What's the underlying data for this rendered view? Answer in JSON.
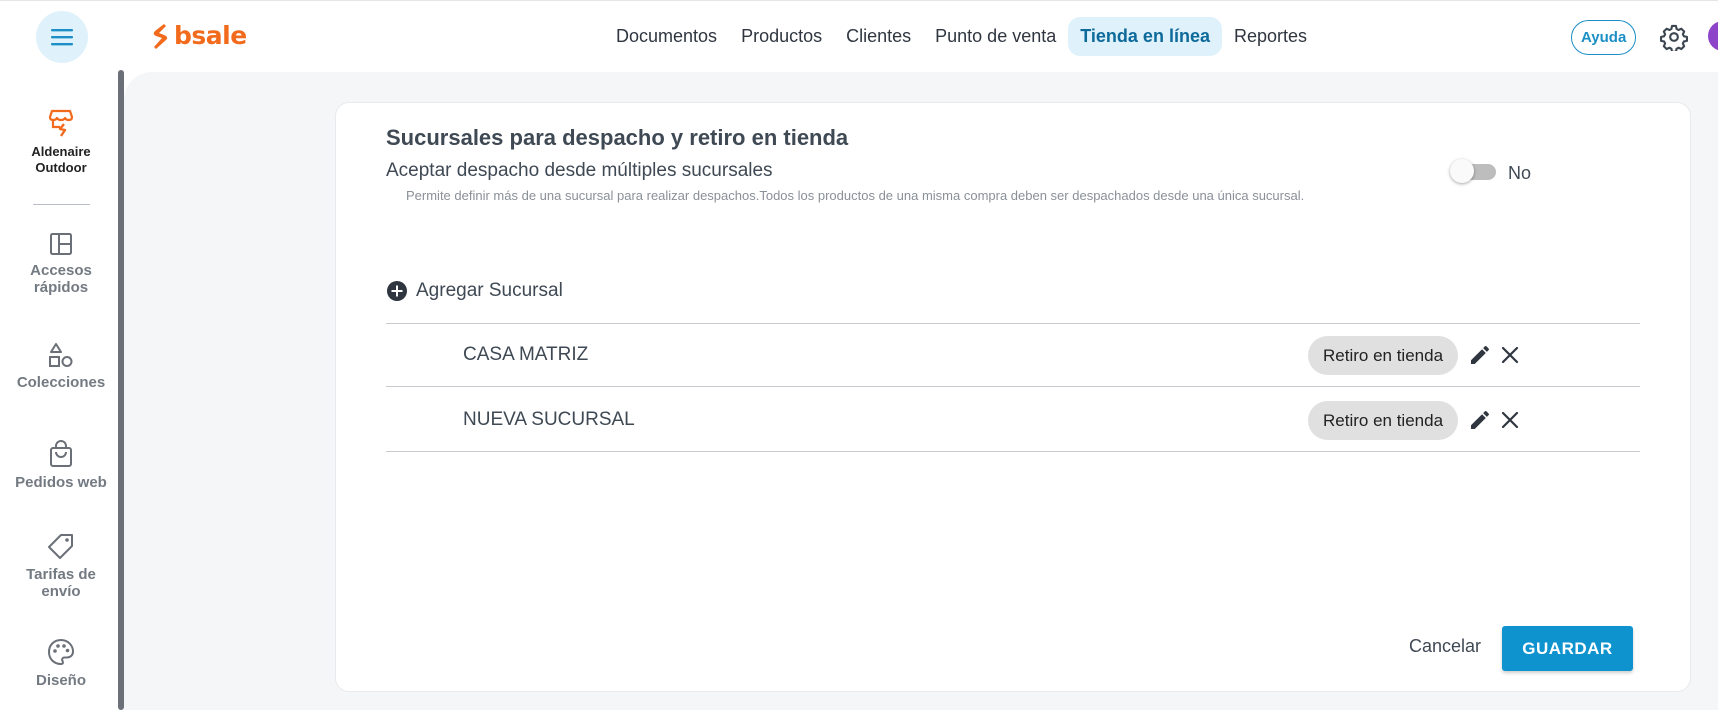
{
  "header": {
    "logo_text": "bsale",
    "nav": [
      {
        "label": "Documentos"
      },
      {
        "label": "Productos"
      },
      {
        "label": "Clientes"
      },
      {
        "label": "Punto de venta"
      },
      {
        "label": "Tienda en línea",
        "active": true
      },
      {
        "label": "Reportes"
      }
    ],
    "help_label": "Ayuda",
    "colors": {
      "brand": "#f26b1d",
      "accent": "#0e93cf",
      "active_bg": "#dff1fb"
    }
  },
  "sidebar": {
    "store": {
      "icon": "store-icon",
      "name_line1": "Aldenaire",
      "name_line2": "Outdoor"
    },
    "items": [
      {
        "icon": "dashboard-icon",
        "line1": "Accesos",
        "line2": "rápidos"
      },
      {
        "icon": "shapes-icon",
        "line1": "Colecciones",
        "line2": ""
      },
      {
        "icon": "shopping-bag-icon",
        "line1": "Pedidos web",
        "line2": ""
      },
      {
        "icon": "tag-icon",
        "line1": "Tarifas de",
        "line2": "envío"
      },
      {
        "icon": "palette-icon",
        "line1": "Diseño",
        "line2": ""
      }
    ]
  },
  "main": {
    "title": "Sucursales para despacho y retiro en tienda",
    "subtitle": "Aceptar despacho desde múltiples sucursales",
    "description": "Permite definir más de una sucursal para realizar despachos.Todos los productos de una misma compra deben ser despachados desde una única sucursal.",
    "toggle": {
      "state": "off",
      "label": "No"
    },
    "add_branch_label": "Agregar Sucursal",
    "branches": [
      {
        "name": "CASA MATRIZ",
        "chip": "Retiro en tienda"
      },
      {
        "name": "NUEVA SUCURSAL",
        "chip": "Retiro en tienda"
      }
    ],
    "cancel_label": "Cancelar",
    "save_label": "GUARDAR"
  }
}
